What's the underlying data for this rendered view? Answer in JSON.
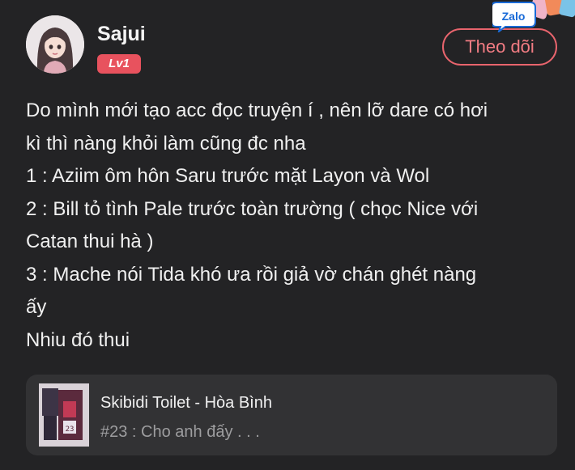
{
  "user": {
    "name": "Sajui",
    "level": "Lv1",
    "avatar_icon": "girl-avatar-icon"
  },
  "follow_button": {
    "label": "Theo dõi"
  },
  "zalo_badge": {
    "label": "Zalo"
  },
  "post": {
    "lines": [
      "Do mình mới tạo acc đọc truyện í , nên lỡ dare có hơi",
      "kì thì nàng khỏi làm cũng đc nha",
      "1 : Aziim ôm hôn Saru trước mặt Layon và Wol",
      "2 : Bill tỏ tình Pale trước toàn trường ( chọc Nice với",
      "Catan thui hà )",
      "3 : Mache nói Tida khó ưa rồi giả vờ chán ghét nàng",
      "ấy",
      "Nhiu đó thui"
    ]
  },
  "story_card": {
    "title": "Skibidi Toilet - Hòa Bình",
    "chapter": "#23 : Cho anh đấy . . .",
    "thumbnail_icon": "story-cover-icon"
  },
  "colors": {
    "background": "#232325",
    "accent": "#e8525e",
    "card": "#323234",
    "muted_text": "#9d9d9f"
  }
}
